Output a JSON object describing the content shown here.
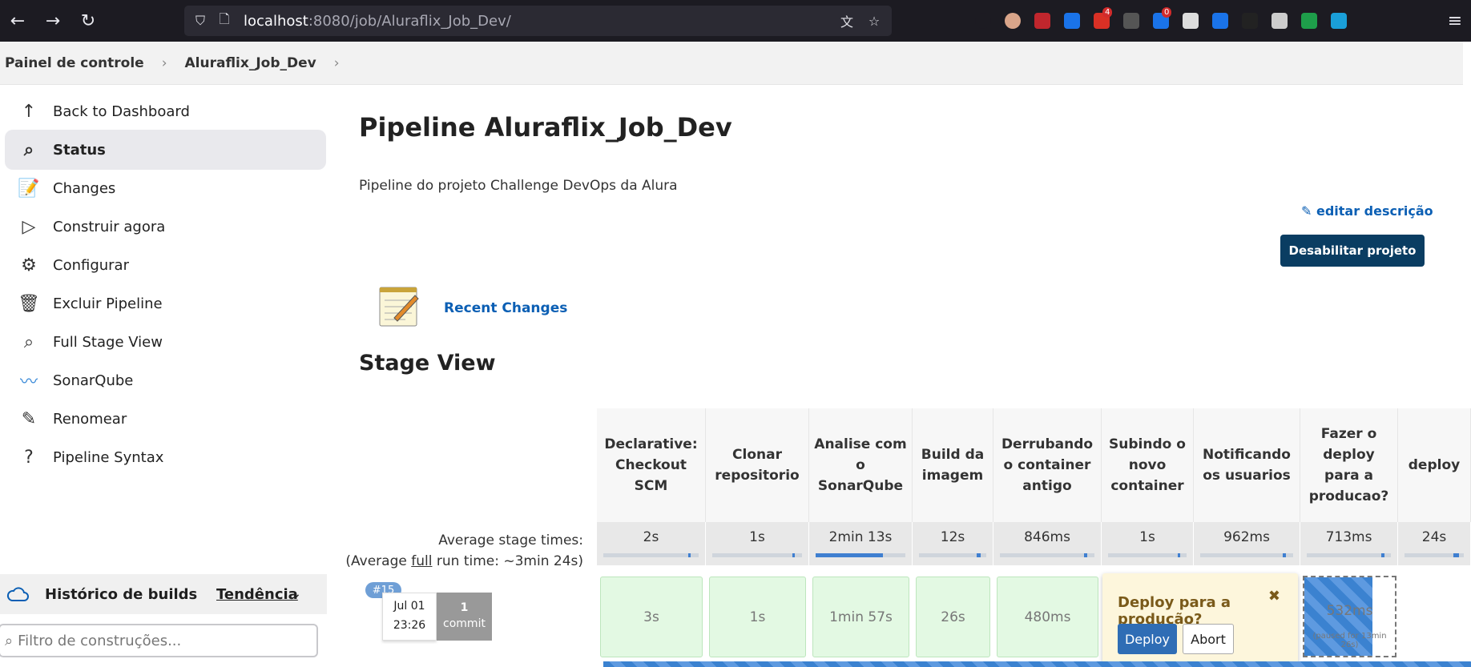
{
  "browser": {
    "url_host": "localhost",
    "url_path": ":8080/job/Aluraflix_Job_Dev/",
    "extensions": [
      {
        "name": "pocket-icon",
        "color": "#1c1b22"
      },
      {
        "name": "profile-icon",
        "color": "#d9a58a"
      },
      {
        "name": "ublock-icon",
        "color": "#c0262d"
      },
      {
        "name": "s-extension-icon",
        "color": "#1a73e8"
      },
      {
        "name": "mail-icon",
        "color": "#d93025",
        "badge": "4"
      },
      {
        "name": "pen-icon",
        "color": "#555"
      },
      {
        "name": "bag-icon",
        "color": "#1a73e8",
        "badge": "0"
      },
      {
        "name": "ghost-icon",
        "color": "#ddd"
      },
      {
        "name": "translate-icon",
        "color": "#1a73e8"
      },
      {
        "name": "dark-icon",
        "color": "#222"
      },
      {
        "name": "settings-icon",
        "color": "#ccc"
      },
      {
        "name": "f-extension-icon",
        "color": "#1e9e4a"
      },
      {
        "name": "react-icon",
        "color": "#1a9fd8"
      }
    ]
  },
  "breadcrumb": {
    "home": "Painel de controle",
    "job": "Aluraflix_Job_Dev",
    "sep": "›"
  },
  "sidebar": {
    "items": [
      {
        "label": "Back to Dashboard",
        "icon": "↑"
      },
      {
        "label": "Status",
        "icon": "⌕"
      },
      {
        "label": "Changes",
        "icon": "📝"
      },
      {
        "label": "Construir agora",
        "icon": "▷"
      },
      {
        "label": "Configurar",
        "icon": "⚙"
      },
      {
        "label": "Excluir Pipeline",
        "icon": "🗑"
      },
      {
        "label": "Full Stage View",
        "icon": "⌕"
      },
      {
        "label": "SonarQube",
        "icon": "〰"
      },
      {
        "label": "Renomear",
        "icon": "✎"
      },
      {
        "label": "Pipeline Syntax",
        "icon": "?"
      }
    ],
    "history_title": "Histórico de builds",
    "trend": "Tendência",
    "filter_placeholder": "Filtro de construções..."
  },
  "main": {
    "title": "Pipeline Aluraflix_Job_Dev",
    "description": "Pipeline do projeto Challenge DevOps da Alura",
    "edit_description": "editar descrição",
    "disable_button": "Desabilitar projeto",
    "recent_changes": "Recent Changes",
    "stage_view_title": "Stage View",
    "avg_label_1": "Average stage times:",
    "avg_label_2_pre": "(Average ",
    "avg_label_2_full": "full",
    "avg_label_2_post": " run time: ~3min 24s)"
  },
  "stages": [
    {
      "name": "Declarative: Checkout SCM",
      "avg": "2s",
      "avg_fraction": 0.02,
      "run": "3s"
    },
    {
      "name": "Clonar repositorio",
      "avg": "1s",
      "avg_fraction": 0.01,
      "run": "1s"
    },
    {
      "name": "Analise com o SonarQube",
      "avg": "2min 13s",
      "avg_fraction": 0.75,
      "run": "1min 57s"
    },
    {
      "name": "Build da imagem",
      "avg": "12s",
      "avg_fraction": 0.06,
      "run": "26s"
    },
    {
      "name": "Derrubando o container antigo",
      "avg": "846ms",
      "avg_fraction": 0.01,
      "run": "480ms"
    },
    {
      "name": "Subindo o novo container",
      "avg": "1s",
      "avg_fraction": 0.01,
      "run": ""
    },
    {
      "name": "Notificando os usuarios",
      "avg": "962ms",
      "avg_fraction": 0.01,
      "run": ""
    },
    {
      "name": "Fazer o deploy para a producao?",
      "avg": "713ms",
      "avg_fraction": 0.01,
      "run": "532ms"
    },
    {
      "name": "deploy",
      "avg": "24s",
      "avg_fraction": 0.1,
      "run": ""
    }
  ],
  "build": {
    "number": "#15",
    "date": "Jul 01",
    "time": "23:26",
    "commits_count": "1",
    "commits_label": "commit",
    "paused_label": "(paused for 13min 26s)"
  },
  "input_popup": {
    "title": "Deploy para a produção?",
    "close": "✖",
    "proceed": "Deploy",
    "abort": "Abort"
  }
}
